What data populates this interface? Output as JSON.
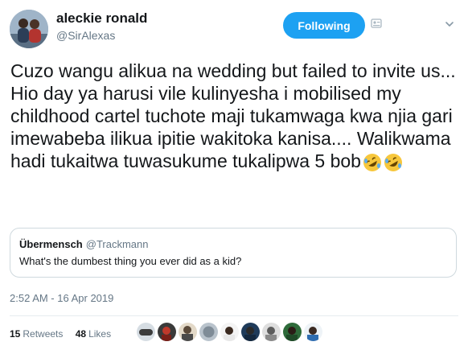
{
  "user": {
    "display_name": "aleckie ronald",
    "handle": "@SirAlexas"
  },
  "follow_button": "Following",
  "tweet": {
    "text": "Cuzo wangu alikua na wedding but failed to invite us... Hio day ya harusi vile kulinyesha i mobilised my childhood cartel tuchote maji tukamwaga kwa njia gari imewabeba ilikua ipitie wakitoka kanisa.... Walikwama hadi tukaitwa tuwasukume tukalipwa 5 bob",
    "emoji": [
      "rolling-on-floor-laughing-emoji",
      "rolling-on-floor-laughing-emoji"
    ]
  },
  "quote": {
    "name": "Übermensch",
    "handle": "@Trackmann",
    "text": "What's the dumbest thing you ever did as a kid?"
  },
  "timestamp": "2:52 AM - 16 Apr 2019",
  "stats": {
    "retweets_count": "15",
    "retweets_label": "Retweets",
    "likes_count": "48",
    "likes_label": "Likes"
  },
  "liker_avatars": 9,
  "colors": {
    "accent": "#1da1f2",
    "muted_text": "#657786",
    "border": "#cfd9de"
  }
}
